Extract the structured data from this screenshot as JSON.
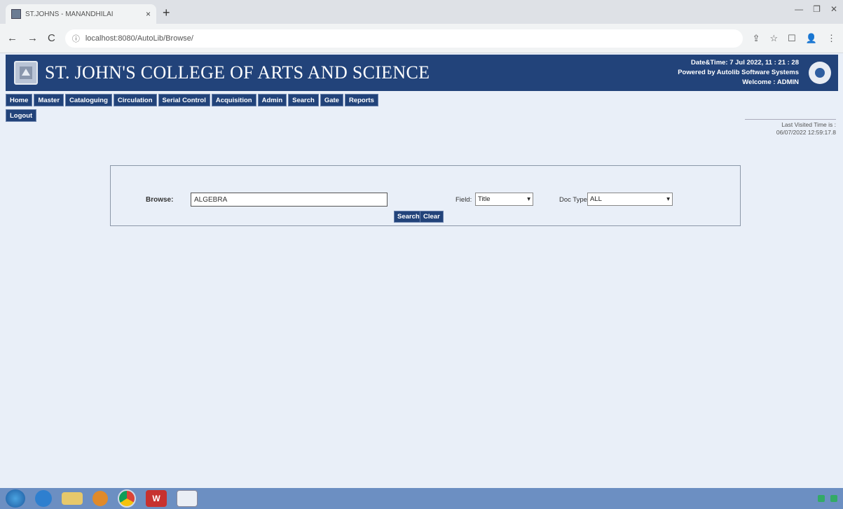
{
  "browser": {
    "tab_title": "ST.JOHNS - MANANDHILAI",
    "tab_close": "×",
    "new_tab": "+",
    "url": "localhost:8080/AutoLib/Browse/",
    "nav_back": "←",
    "nav_forward": "→",
    "nav_reload": "C",
    "minimize": "—",
    "maximize": "❐",
    "close": "✕"
  },
  "header": {
    "college_name": "ST. JOHN'S COLLEGE OF ARTS AND SCIENCE",
    "datetime": "Date&Time: 7 Jul 2022, 11 : 21 : 28",
    "powered_by": "Powered by Autolib Software Systems",
    "welcome": "Welcome : ADMIN"
  },
  "menu": {
    "items": [
      "Home",
      "Master",
      "Cataloguing",
      "Circulation",
      "Serial Control",
      "Acquisition",
      "Admin",
      "Search",
      "Gate",
      "Reports"
    ],
    "logout": "Logout"
  },
  "last_visited": {
    "label": "Last Visited Time is :",
    "value": "06/07/2022 12:59:17.8"
  },
  "browse": {
    "label": "Browse:",
    "value": "ALGEBRA",
    "field_label": "Field:",
    "field_value": "Title",
    "doctype_label": "Doc Type:",
    "doctype_value": "ALL",
    "search_button": "Search",
    "clear_button": "Clear"
  },
  "taskbar": {
    "wps_label": "W"
  }
}
